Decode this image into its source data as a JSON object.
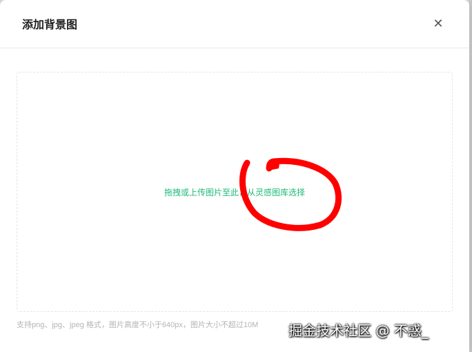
{
  "dialog": {
    "title": "添加背景图",
    "close_glyph": "✕"
  },
  "upload": {
    "prompt": "拖拽或上传图片至此，从灵感图库选择",
    "hint": "支持png、jpg、jpeg 格式，图片高度不小于640px，图片大小不超过10M",
    "accent_color": "#1db97a"
  },
  "annotation": {
    "color": "#ff0000"
  },
  "watermark": {
    "text": "掘金技术社区 @ 不惑_"
  }
}
